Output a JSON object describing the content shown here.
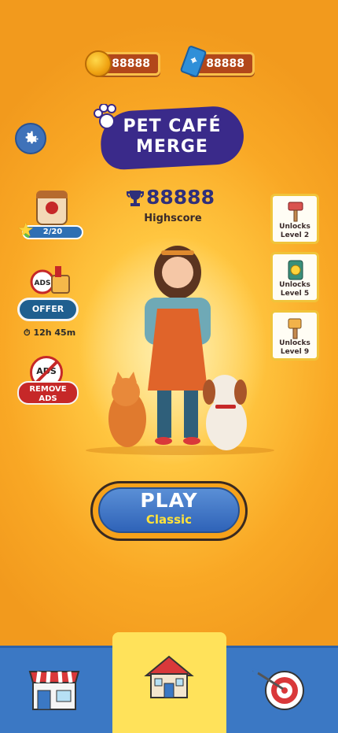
{
  "currency": {
    "coins": "88888",
    "tickets": "88888"
  },
  "logo": {
    "line1": "PET CAFÉ",
    "line2": "MERGE"
  },
  "highscore": {
    "value": "88888",
    "label": "Highscore"
  },
  "left_panel": {
    "progress_text": "2/20",
    "progress_fraction": 0.1,
    "offer_label": "OFFER",
    "offer_timer": "12h 45m",
    "noads_badge": "ADS",
    "offer_badge": "ADS",
    "remove_ads_line1": "REMOVE",
    "remove_ads_line2": "ADS"
  },
  "unlocks": [
    {
      "line1": "Unlocks",
      "line2": "Level 2",
      "icon": "hammer-icon"
    },
    {
      "line1": "Unlocks",
      "line2": "Level 5",
      "icon": "phone-icon"
    },
    {
      "line1": "Unlocks",
      "line2": "Level 9",
      "icon": "brush-icon"
    }
  ],
  "play": {
    "label": "PLAY",
    "mode": "Classic"
  },
  "nav": {
    "items": [
      {
        "icon": "shop-icon"
      },
      {
        "icon": "home-icon",
        "active": true
      },
      {
        "icon": "target-icon"
      }
    ]
  },
  "colors": {
    "accent_blue": "#3b78c4",
    "active_tab": "#ffe25a",
    "logo_bg": "#3a2a8a"
  }
}
